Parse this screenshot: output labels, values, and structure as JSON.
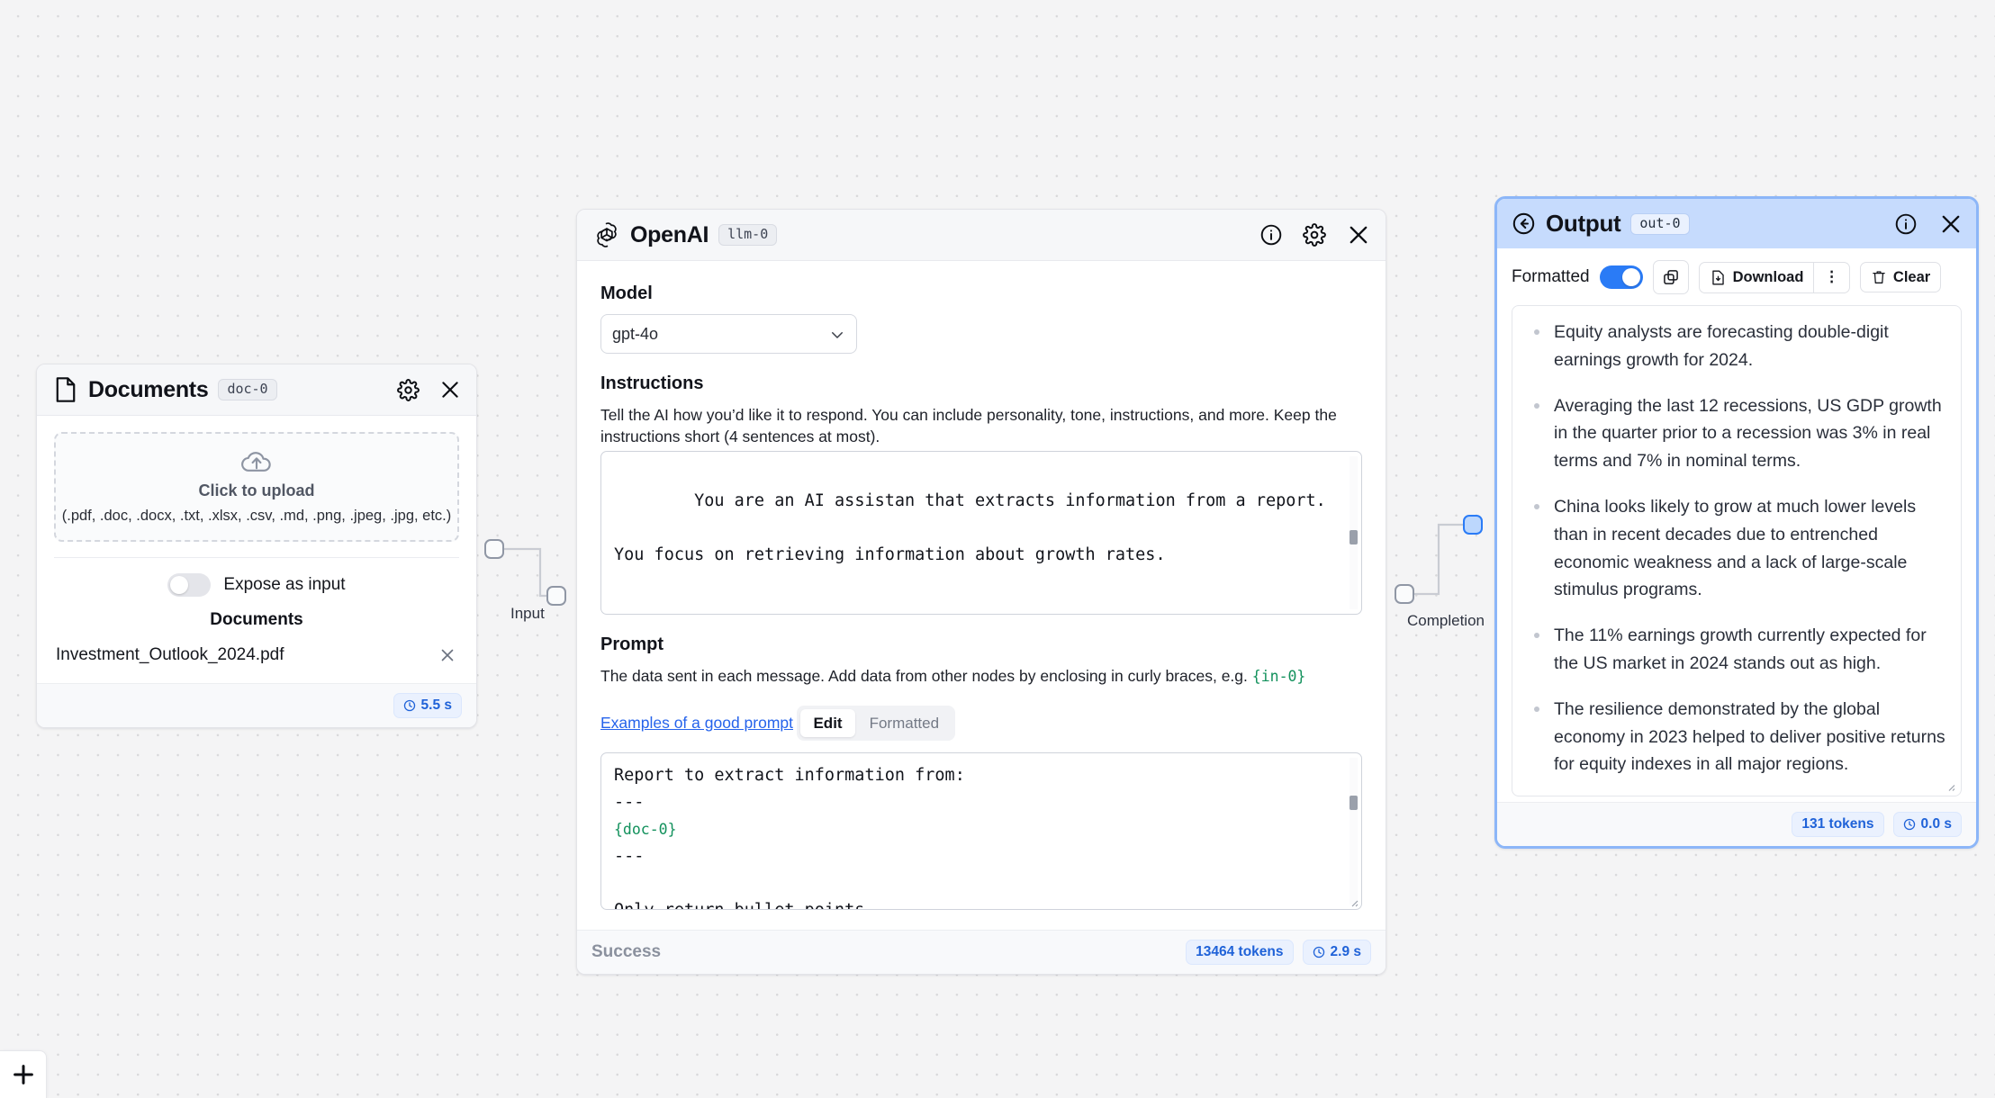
{
  "canvas": {
    "add_button_label": "+"
  },
  "documents_node": {
    "title": "Documents",
    "tag": "doc-0",
    "dropzone": {
      "label": "Click to upload",
      "hint": "(.pdf, .doc, .docx, .txt, .xlsx, .csv, .md, .png, .jpeg, .jpg, etc.)",
      "icon": "cloud-upload-icon"
    },
    "expose_toggle": {
      "label": "Expose as input",
      "state": "off"
    },
    "list_heading": "Documents",
    "files": [
      {
        "name": "Investment_Outlook_2024.pdf"
      }
    ],
    "footer": {
      "duration": "5.5 s"
    },
    "header_icons": [
      "gear-icon",
      "close-icon"
    ]
  },
  "openai_node": {
    "title": "OpenAI",
    "tag": "llm-0",
    "header_icons": [
      "info-icon",
      "gear-icon",
      "close-icon"
    ],
    "model": {
      "label": "Model",
      "value": "gpt-4o"
    },
    "instructions": {
      "label": "Instructions",
      "help": "Tell the AI how you’d like it to respond. You can include personality, tone, instructions, and more. Keep the instructions short (4 sentences at most).",
      "value": "You are an AI assistan that extracts information from a report.\n\nYou focus on retrieving information about growth rates."
    },
    "prompt": {
      "label": "Prompt",
      "help_prefix": "The data sent in each message. Add data from other nodes by enclosing in curly braces, e.g. ",
      "help_token": "{in-0}",
      "link": "Examples of a good prompt",
      "tabs": [
        "Edit",
        "Formatted"
      ],
      "active_tab": "Edit",
      "value_line1": "Report to extract information from:",
      "value_line2": "---",
      "value_token": "{doc-0}",
      "value_line4": "---",
      "value_line5": "",
      "value_line6": "Only return bullet points."
    },
    "footer": {
      "status": "Success",
      "tokens": "13464 tokens",
      "duration": "2.9 s"
    }
  },
  "output_node": {
    "title": "Output",
    "tag": "out-0",
    "back_icon": "back-arrow-icon",
    "header_icons": [
      "info-icon",
      "close-icon"
    ],
    "toolbar": {
      "formatted_label": "Formatted",
      "formatted_state": "on",
      "copy_label": "copy-icon",
      "download_label": "Download",
      "more_label": "⋮",
      "clear_label": "Clear"
    },
    "bullets": [
      "Equity analysts are forecasting double-digit earnings growth for 2024.",
      "Averaging the last 12 recessions, US GDP growth in the quarter prior to a recession was 3% in real terms and 7% in nominal terms.",
      "China looks likely to grow at much lower levels than in recent decades due to entrenched economic weakness and a lack of large-scale stimulus programs.",
      "The 11% earnings growth currently expected for the US market in 2024 stands out as high.",
      "The resilience demonstrated by the global economy in 2023 helped to deliver positive returns for equity indexes in all major regions."
    ],
    "footer": {
      "tokens": "131 tokens",
      "duration": "0.0 s"
    }
  },
  "edges": [
    {
      "label": "Input"
    },
    {
      "label": "Completion"
    }
  ],
  "colors": {
    "accent": "#2a7bf6",
    "output_border": "#8cb6f8",
    "output_header": "#c6dbfd",
    "token_blue": "#1f62d8",
    "mono_green": "#12915c",
    "link_blue": "#2563eb"
  }
}
